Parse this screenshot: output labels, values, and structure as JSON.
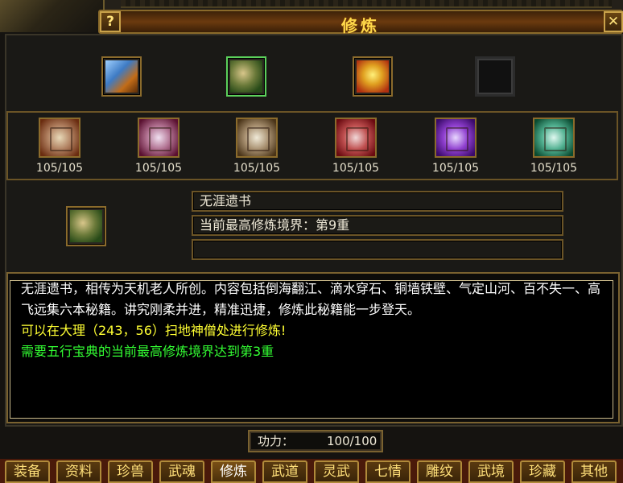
{
  "window": {
    "title": "修炼",
    "help_label": "?",
    "close_label": "✕"
  },
  "top_slots": [
    {
      "name": "book",
      "state": "normal"
    },
    {
      "name": "scroll-bundle",
      "state": "selected"
    },
    {
      "name": "gold-treasure",
      "state": "normal"
    },
    {
      "name": "empty",
      "state": "empty"
    }
  ],
  "skills": [
    {
      "count": "105/105"
    },
    {
      "count": "105/105"
    },
    {
      "count": "105/105"
    },
    {
      "count": "105/105"
    },
    {
      "count": "105/105"
    },
    {
      "count": "105/105"
    }
  ],
  "detail": {
    "name": "无涯遗书",
    "level": "当前最高修炼境界：第9重",
    "extra": ""
  },
  "description": {
    "text": "无涯遗书，相传为天机老人所创。内容包括倒海翻江、滴水穿石、铜墙铁壁、气定山河、百不失一、高飞远集六本秘籍。讲究刚柔并进，精准迅捷，修炼此秘籍能一步登天。",
    "location": "可以在大理（243，56）扫地神僧处进行修炼!",
    "requirement": "需要五行宝典的当前最高修炼境界达到第3重"
  },
  "gongli": {
    "label": "功力：",
    "value": "100/100"
  },
  "tabs": [
    {
      "label": "装备",
      "active": false
    },
    {
      "label": "资料",
      "active": false
    },
    {
      "label": "珍兽",
      "active": false
    },
    {
      "label": "武魂",
      "active": false
    },
    {
      "label": "修炼",
      "active": true
    },
    {
      "label": "武道",
      "active": false
    },
    {
      "label": "灵武",
      "active": false
    },
    {
      "label": "七情",
      "active": false
    },
    {
      "label": "雕纹",
      "active": false
    },
    {
      "label": "武境",
      "active": false
    },
    {
      "label": "珍藏",
      "active": false
    },
    {
      "label": "其他",
      "active": false
    }
  ],
  "colors": {
    "title": "#ffd94a",
    "frame_gold": "#8b6b2c",
    "desc_white": "#ffffff",
    "desc_yellow": "#ffff33",
    "desc_green": "#33ff33"
  }
}
